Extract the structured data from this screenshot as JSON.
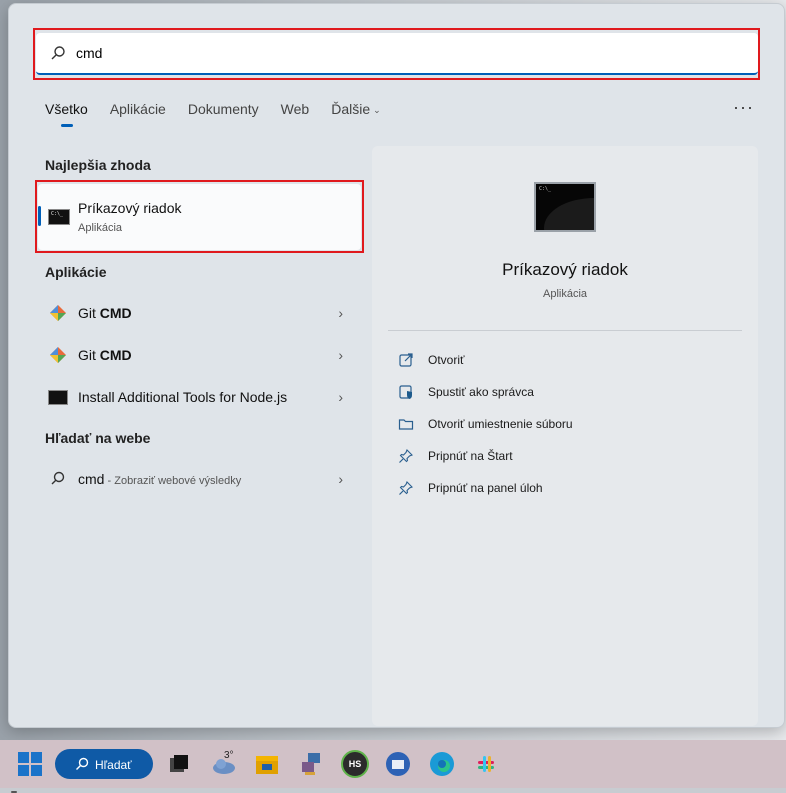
{
  "search": {
    "value": "cmd"
  },
  "tabs": [
    {
      "label": "Všetko",
      "active": true
    },
    {
      "label": "Aplikácie"
    },
    {
      "label": "Dokumenty"
    },
    {
      "label": "Web"
    },
    {
      "label": "Ďalšie"
    }
  ],
  "more_label": "···",
  "best_match": {
    "heading": "Najlepšia zhoda",
    "title": "Príkazový riadok",
    "subtitle": "Aplikácia",
    "icon_text": "C:\\_"
  },
  "apps": {
    "heading": "Aplikácie",
    "items": [
      {
        "prefix": "Git ",
        "bold": "CMD",
        "icon": "git-icon"
      },
      {
        "prefix": "Git ",
        "bold": "CMD",
        "icon": "git-icon"
      },
      {
        "prefix": "Install Additional Tools for Node.js",
        "bold": "",
        "icon": "cmd-icon"
      }
    ]
  },
  "web": {
    "heading": "Hľadať na webe",
    "query": "cmd",
    "note": " - Zobraziť webové výsledky"
  },
  "detail": {
    "title": "Príkazový riadok",
    "subtitle": "Aplikácia",
    "actions": [
      {
        "label": "Otvoriť",
        "icon": "open-external-icon"
      },
      {
        "label": "Spustiť ako správca",
        "icon": "shield-icon"
      },
      {
        "label": "Otvoriť umiestnenie súboru",
        "icon": "folder-icon"
      },
      {
        "label": "Pripnúť na Štart",
        "icon": "pin-icon"
      },
      {
        "label": "Pripnúť na panel úloh",
        "icon": "pin-icon"
      }
    ]
  },
  "taskbar": {
    "search_label": "Hľadať",
    "weather_temp": "3°",
    "hs_label": "HS"
  },
  "colors": {
    "accent": "#005fb8",
    "highlight": "#e0191d",
    "taskbar": "#d1c1c7"
  }
}
